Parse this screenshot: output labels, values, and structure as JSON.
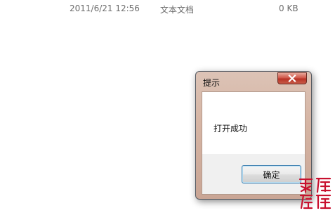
{
  "file_row": {
    "date": "2011/6/21 12:56",
    "type": "文本文档",
    "size": "0 KB"
  },
  "dialog": {
    "title": "提示",
    "message": "打开成功",
    "ok_label": "确定",
    "close_icon": "close-icon"
  },
  "watermark": {
    "text": "網絡天涯",
    "color": "#c8102e"
  }
}
